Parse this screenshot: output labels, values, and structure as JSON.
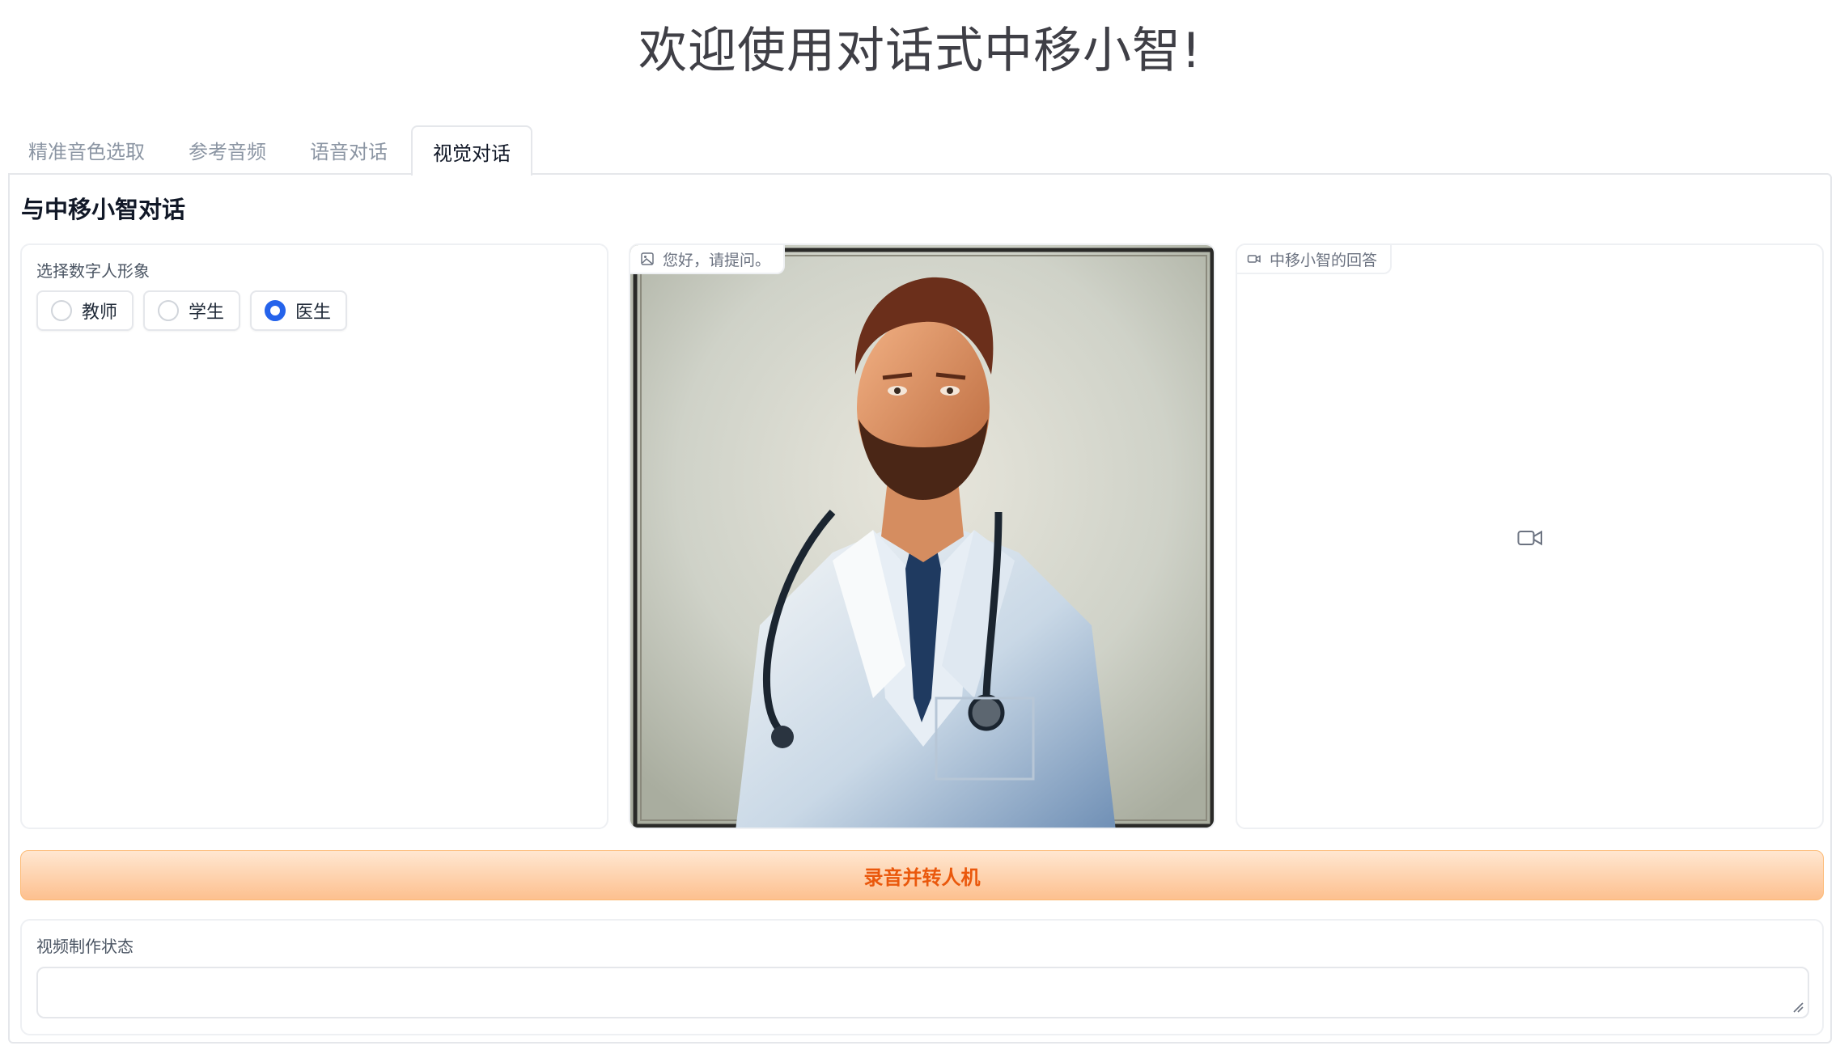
{
  "page_title": "欢迎使用对话式中移小智!",
  "tabs": [
    {
      "label": "精准音色选取",
      "selected": false
    },
    {
      "label": "参考音频",
      "selected": false
    },
    {
      "label": "语音对话",
      "selected": false
    },
    {
      "label": "视觉对话",
      "selected": true
    }
  ],
  "section_title": "与中移小智对话",
  "avatar_selector": {
    "label": "选择数字人形象",
    "options": [
      {
        "label": "教师",
        "checked": false
      },
      {
        "label": "学生",
        "checked": false
      },
      {
        "label": "医生",
        "checked": true
      }
    ]
  },
  "image_panel": {
    "label": "您好，请提问。",
    "icon": "image-icon"
  },
  "video_panel": {
    "label": "中移小智的回答",
    "icon": "video-camera-icon"
  },
  "record_button": {
    "label": "录音并转人机"
  },
  "status": {
    "label": "视频制作状态",
    "value": ""
  },
  "colors": {
    "accent": "#2563eb",
    "button_text": "#ea580c",
    "button_bg_top": "#ffe7d1",
    "button_bg_bottom": "#fdc08f"
  }
}
